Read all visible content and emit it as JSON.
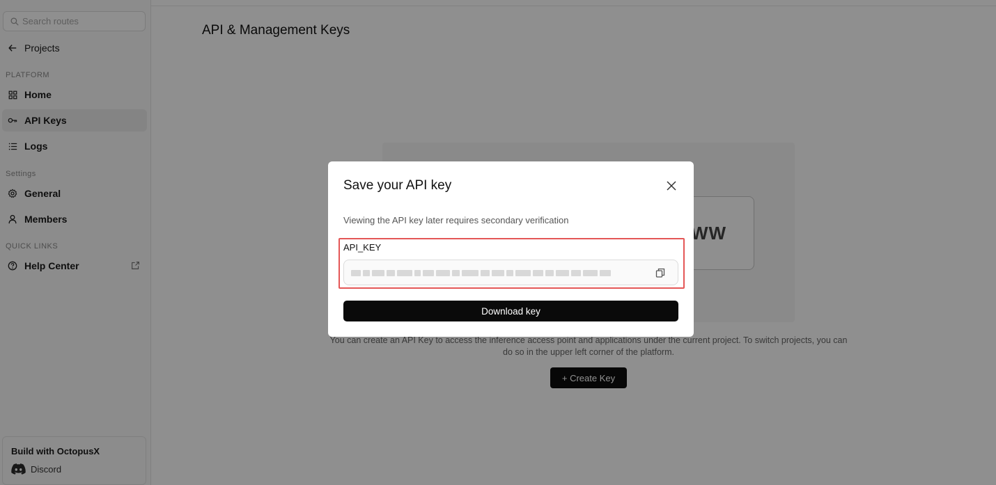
{
  "sidebar": {
    "search_placeholder": "Search routes",
    "back_label": "Projects",
    "sections": {
      "platform": "PLATFORM",
      "settings": "Settings",
      "quick_links": "QUICK LINKS"
    },
    "items": {
      "home": "Home",
      "api_keys": "API Keys",
      "logs": "Logs",
      "general": "General",
      "members": "Members",
      "help_center": "Help Center"
    },
    "active_item": "API Keys",
    "build_card": {
      "title": "Build with OctopusX",
      "discord": "Discord"
    }
  },
  "main": {
    "title": "API & Management Keys",
    "empty_state_text": "WW",
    "description": "You can create an API Key to access the inference access point and applications under the current project. To switch projects, you can do so in the upper left corner of the platform.",
    "create_button": "+ Create Key"
  },
  "modal": {
    "title": "Save your API key",
    "subtitle": "Viewing the API key later requires secondary verification",
    "key_label": "API_KEY",
    "download_button": "Download key"
  },
  "colors": {
    "highlight": "#e45656",
    "primary_button": "#0a0a0a",
    "overlay": "rgba(0,0,0,0.44)"
  }
}
